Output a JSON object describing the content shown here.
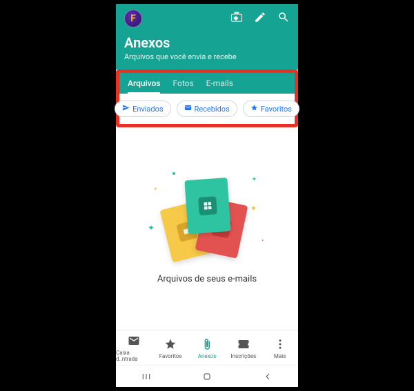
{
  "header": {
    "avatar_letter": "F",
    "title": "Anexos",
    "subtitle": "Arquivos que você envia e recebe"
  },
  "tabs": [
    {
      "label": "Arquivos",
      "active": true
    },
    {
      "label": "Fotos",
      "active": false
    },
    {
      "label": "E-mails",
      "active": false
    }
  ],
  "chips": {
    "sent": "Enviados",
    "received": "Recebidos",
    "favorites": "Favoritos"
  },
  "empty_state": {
    "text": "Arquivos de seus e-mails"
  },
  "bottomnav": {
    "inbox": "Caixa d..ntrada",
    "favorites": "Favoritos",
    "attachments": "Anexos",
    "subscriptions": "Inscrições",
    "more": "Mais"
  },
  "colors": {
    "accent": "#15a393",
    "highlight": "#e53224",
    "blue": "#2176ff"
  }
}
